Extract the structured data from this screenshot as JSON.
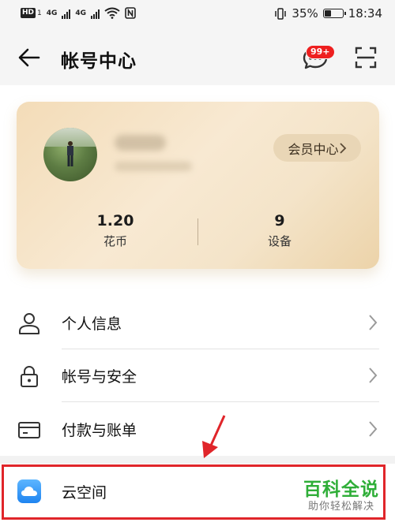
{
  "status_bar": {
    "hd_label": "HD",
    "sim1": "1",
    "net1": "4G",
    "net2": "4G",
    "battery_percent": "35%",
    "battery_level": 0.35,
    "time": "18:34"
  },
  "header": {
    "title": "帐号中心",
    "message_badge": "99+"
  },
  "profile_card": {
    "member_center_label": "会员中心",
    "stats": [
      {
        "value": "1.20",
        "label": "花币"
      },
      {
        "value": "9",
        "label": "设备"
      }
    ]
  },
  "menu": [
    {
      "label": "个人信息",
      "icon": "person-icon"
    },
    {
      "label": "帐号与安全",
      "icon": "lock-icon"
    },
    {
      "label": "付款与账单",
      "icon": "card-icon"
    }
  ],
  "cloud_item": {
    "label": "云空间",
    "icon": "cloud-icon"
  },
  "watermark": {
    "title": "百科全说",
    "subtitle": "助你轻松解决"
  },
  "colors": {
    "card_gold": "#f3dcb8",
    "highlight_red": "#e0252a",
    "watermark_green": "#2fae38",
    "badge_red": "#ee1f1f"
  }
}
